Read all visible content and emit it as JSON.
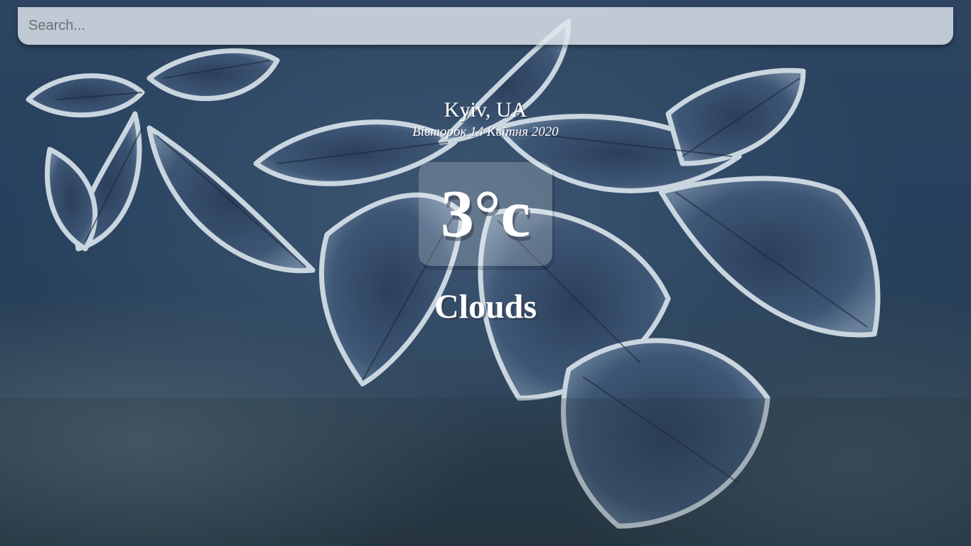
{
  "search": {
    "placeholder": "Search..."
  },
  "location": {
    "city_country": "Kyiv, UA",
    "date": "Вівторок 14 Квітня 2020"
  },
  "weather": {
    "temperature": "3°c",
    "condition": "Clouds"
  },
  "background": {
    "description_icon": "frosted-leaves-background",
    "colors": [
      "#26405d",
      "#3d5672",
      "#24333f"
    ]
  }
}
